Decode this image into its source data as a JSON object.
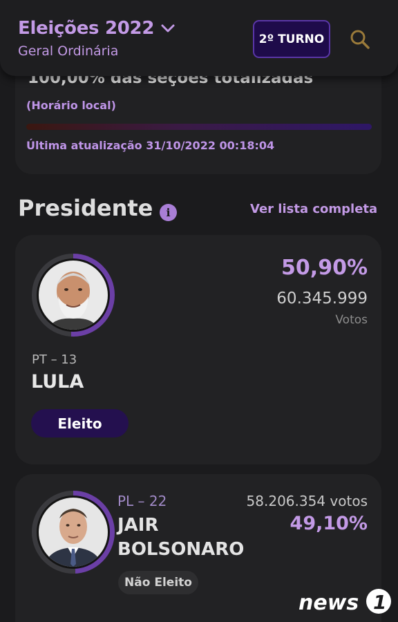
{
  "header": {
    "title": "Eleições 2022",
    "subtitle": "Geral Ordinária",
    "turno_button": "2º TURNO"
  },
  "status": {
    "sections_totalized": "100,00% das seções totalizadas",
    "local_time_note": "(Horário local)",
    "progress_fraction": 1.0,
    "last_update": "Última atualização 31/10/2022 00:18:04"
  },
  "section": {
    "title": "Presidente",
    "see_all": "Ver lista completa"
  },
  "candidates": [
    {
      "party": "PT – 13",
      "name": "LULA",
      "percent": "50,90%",
      "votes": "60.345.999",
      "votes_label": "Votos",
      "result": "Eleito"
    },
    {
      "party": "PL – 22",
      "name": "JAIR BOLSONARO",
      "percent": "49,10%",
      "votes": "58.206.354 votos",
      "result": "Não Eleito"
    }
  ],
  "colors": {
    "accent": "#c39ae6",
    "background": "#1b1b1d",
    "card": "#222224",
    "elected_badge": "#24104f",
    "turno_bg": "#1e0b4a"
  },
  "icons": [
    "chevron-down-icon",
    "search-icon",
    "info-icon"
  ],
  "watermark": "news1"
}
